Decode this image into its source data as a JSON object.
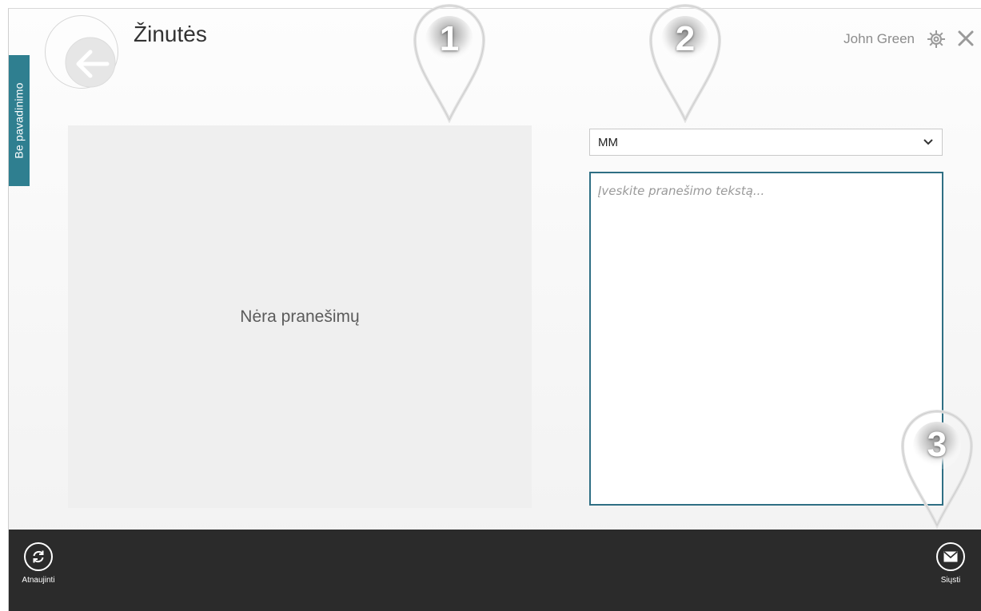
{
  "header": {
    "title": "Žinutės",
    "user_name": "John Green",
    "side_tab_label": "Be pavadinimo"
  },
  "messages": {
    "empty_text": "Nėra pranešimų"
  },
  "compose": {
    "recipient_value": "MM",
    "message_placeholder": "Įveskite pranešimo tekstą..."
  },
  "app_bar": {
    "refresh_label": "Atnaujinti",
    "send_label": "Siųsti"
  },
  "callouts": [
    "1",
    "2",
    "3"
  ],
  "colors": {
    "accent": "#2f7f90",
    "app_bar": "#2b2b2b",
    "input_border": "#2f6f84"
  },
  "icons": [
    "back-arrow-icon",
    "gear-icon",
    "close-icon",
    "chevron-down-icon",
    "refresh-icon",
    "mail-icon"
  ]
}
